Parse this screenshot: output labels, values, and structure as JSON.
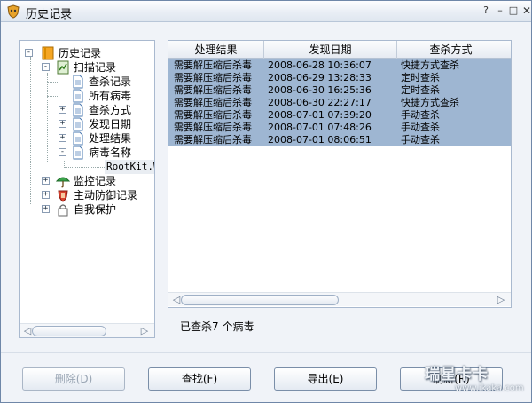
{
  "window": {
    "title": "历史记录",
    "icons": {
      "app": "shield-app-icon",
      "help": "help-icon",
      "minimize": "minimize-icon",
      "maximize": "maximize-icon",
      "close": "close-icon"
    }
  },
  "tree": {
    "root": "历史记录",
    "scan_records": "扫描记录",
    "kill_records": "查杀记录",
    "all_viruses": "所有病毒",
    "kill_method": "查杀方式",
    "found_date": "发现日期",
    "process_result": "处理结果",
    "virus_name": "病毒名称",
    "selected_virus": "RootKit.Wi",
    "monitor_records": "监控记录",
    "active_defense_records": "主动防御记录",
    "self_protection": "自我保护"
  },
  "table": {
    "columns": [
      "处理结果",
      "发现日期",
      "查杀方式"
    ],
    "rows": [
      [
        "需要解压缩后杀毒",
        "2008-06-28 10:36:07",
        "快捷方式查杀"
      ],
      [
        "需要解压缩后杀毒",
        "2008-06-29 13:28:33",
        "定时查杀"
      ],
      [
        "需要解压缩后杀毒",
        "2008-06-30 16:25:36",
        "定时查杀"
      ],
      [
        "需要解压缩后杀毒",
        "2008-06-30 22:27:17",
        "快捷方式查杀"
      ],
      [
        "需要解压缩后杀毒",
        "2008-07-01 07:39:20",
        "手动查杀"
      ],
      [
        "需要解压缩后杀毒",
        "2008-07-01 07:48:26",
        "手动查杀"
      ],
      [
        "需要解压缩后杀毒",
        "2008-07-01 08:06:51",
        "手动查杀"
      ]
    ]
  },
  "status": "已查杀7 个病毒",
  "buttons": {
    "delete": "删除(D)",
    "find": "查找(F)",
    "export": "导出(E)",
    "refresh": "刷新(R)"
  },
  "watermark": {
    "brand": "瑞星卡卡",
    "url": "www.ikaka.com"
  },
  "colors": {
    "selection": "#9eb6d2",
    "frame": "#6f87a8"
  }
}
